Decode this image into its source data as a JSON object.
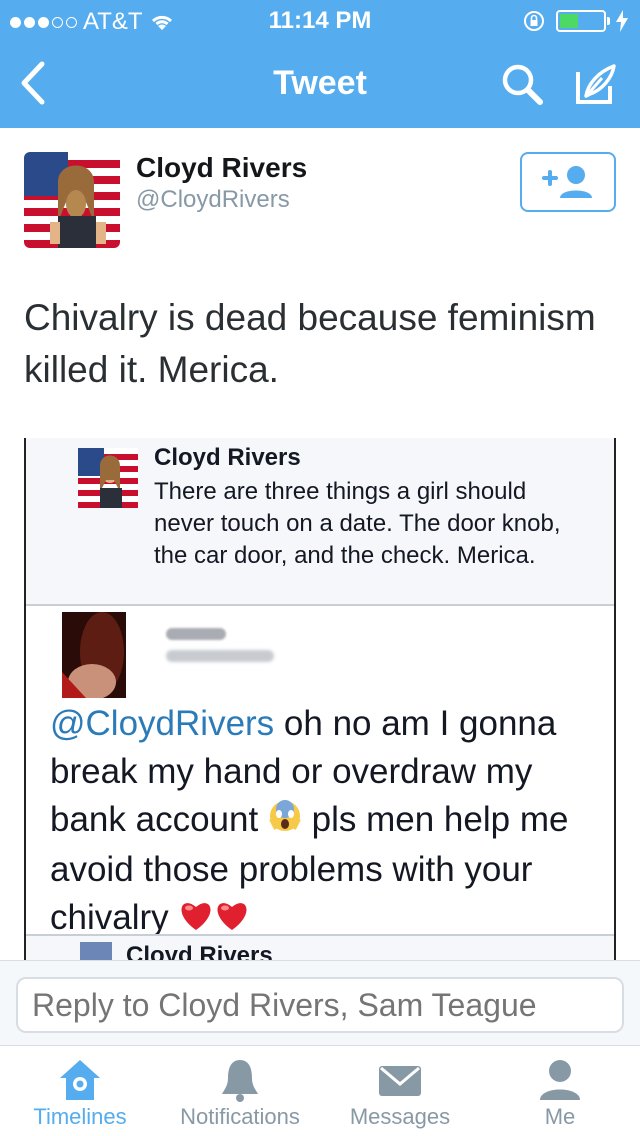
{
  "status_bar": {
    "carrier": "AT&T",
    "time": "11:14 PM"
  },
  "nav": {
    "title": "Tweet"
  },
  "tweet": {
    "author_name": "Cloyd Rivers",
    "author_handle": "@CloydRivers",
    "text": "Chivalry is dead because feminism killed it. Merica."
  },
  "embedded_image": {
    "quoted_tweet": {
      "name": "Cloyd Rivers",
      "text": "There are three things a girl should never touch on a date. The door knob, the car door, and the check. Merica."
    },
    "reply": {
      "mention": "@CloydRivers",
      "text_part1": " oh no am I gonna break my hand or overdraw my bank account ",
      "text_part2": " pls men help me avoid those problems with your chivalry "
    },
    "third_tweet_name": "Cloyd Rivers"
  },
  "reply_bar": {
    "placeholder": "Reply to Cloyd Rivers, Sam Teague"
  },
  "tabs": [
    {
      "label": "Timelines",
      "icon": "home-icon",
      "active": true
    },
    {
      "label": "Notifications",
      "icon": "bell-icon",
      "active": false
    },
    {
      "label": "Messages",
      "icon": "envelope-icon",
      "active": false
    },
    {
      "label": "Me",
      "icon": "person-icon",
      "active": false
    }
  ],
  "colors": {
    "accent": "#55acee",
    "tab_inactive": "#8899a6",
    "mention": "#2b7bb9"
  }
}
